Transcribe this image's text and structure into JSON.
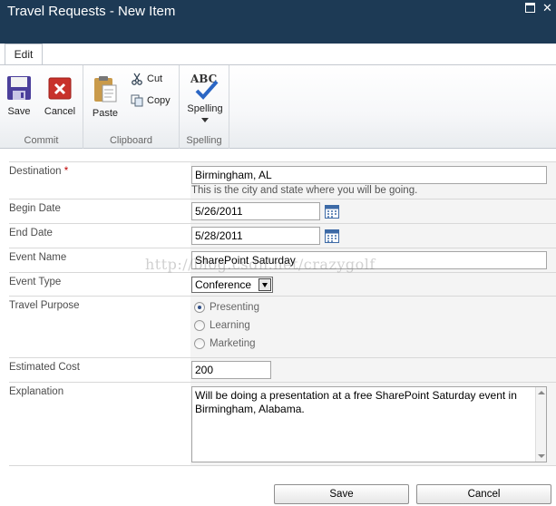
{
  "window": {
    "title": "Travel Requests - New Item"
  },
  "ribbon": {
    "tab": "Edit",
    "groups": {
      "commit": {
        "label": "Commit",
        "save": "Save",
        "cancel": "Cancel"
      },
      "clipboard": {
        "label": "Clipboard",
        "paste": "Paste",
        "cut": "Cut",
        "copy": "Copy"
      },
      "spelling": {
        "label": "Spelling",
        "spelling": "Spelling",
        "icon_text": "ABC"
      }
    }
  },
  "form": {
    "destination": {
      "label": "Destination",
      "required_mark": "*",
      "value": "Birmingham, AL",
      "description": "This is the city and state where you will be going."
    },
    "begin_date": {
      "label": "Begin Date",
      "value": "5/26/2011"
    },
    "end_date": {
      "label": "End Date",
      "value": "5/28/2011"
    },
    "event_name": {
      "label": "Event Name",
      "value": "SharePoint Saturday"
    },
    "event_type": {
      "label": "Event Type",
      "value": "Conference"
    },
    "travel_purpose": {
      "label": "Travel Purpose",
      "options": [
        "Presenting",
        "Learning",
        "Marketing"
      ],
      "selected": "Presenting"
    },
    "estimated_cost": {
      "label": "Estimated Cost",
      "value": "200"
    },
    "explanation": {
      "label": "Explanation",
      "value": "Will be doing a presentation at a free SharePoint Saturday event in Birmingham, Alabama."
    }
  },
  "actions": {
    "save": "Save",
    "cancel": "Cancel"
  },
  "watermark": "http://blog.csdn.net/crazygolf"
}
